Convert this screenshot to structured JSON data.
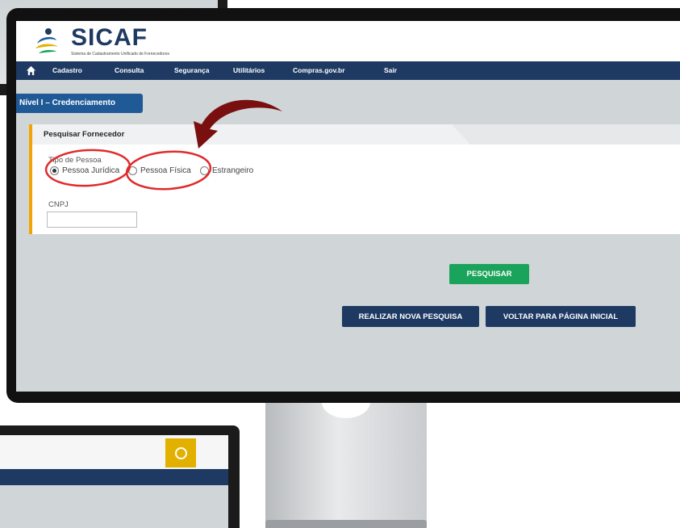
{
  "app": {
    "name": "SICAF",
    "subtitle": "Sistema de Cadastramento Unificado de Fornecedores"
  },
  "nav": {
    "items": [
      "Cadastro",
      "Consulta",
      "Segurança",
      "Utilitários",
      "Compras.gov.br",
      "Sair"
    ]
  },
  "level_tag": "Nível I – Credenciamento",
  "panel": {
    "title": "Pesquisar Fornecedor",
    "tipo_label": "Tipo de Pessoa",
    "options": [
      {
        "label": "Pessoa Jurídica",
        "selected": true
      },
      {
        "label": "Pessoa Física",
        "selected": false
      },
      {
        "label": "Estrangeiro",
        "selected": false
      }
    ],
    "cnpj_label": "CNPJ",
    "cnpj_value": ""
  },
  "buttons": {
    "search": "PESQUISAR",
    "new_search": "REALIZAR NOVA PESQUISA",
    "back": "VOLTAR PARA PÁGINA INICIAL"
  },
  "colors": {
    "navy": "#1e3a63",
    "tag_blue": "#1f5a97",
    "green": "#1aa35a",
    "accent_orange": "#f2a400",
    "annotation_red": "#e02b2b",
    "arrow_dark_red": "#7a0f0f"
  }
}
